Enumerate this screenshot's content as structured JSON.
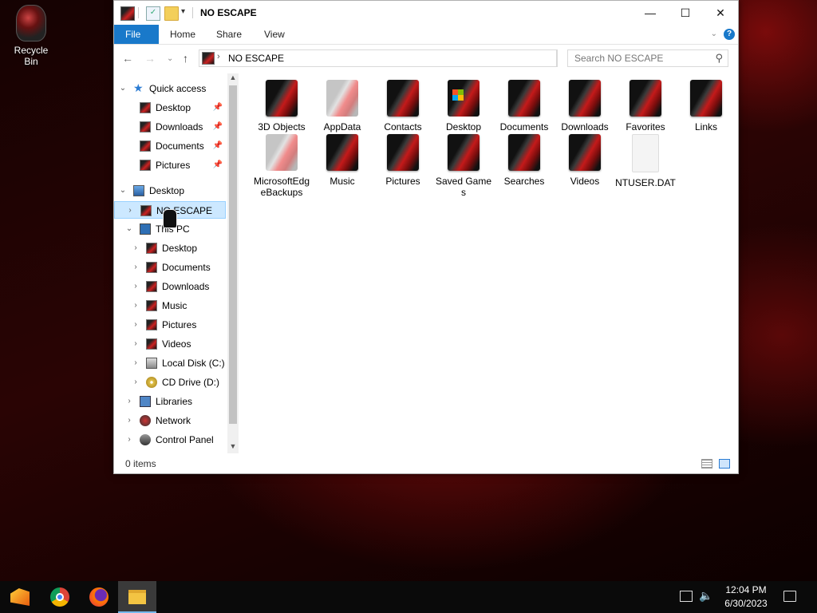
{
  "desktop": {
    "recycle_bin_label": "Recycle Bin"
  },
  "window": {
    "title": "NO ESCAPE",
    "ribbon_tabs": [
      "File",
      "Home",
      "Share",
      "View"
    ],
    "address_path": "NO ESCAPE",
    "search_placeholder": "Search NO ESCAPE",
    "status": "0 items"
  },
  "nav_tree": [
    {
      "label": "Quick access",
      "level": 0,
      "chevron": "down",
      "icon": "star-icon"
    },
    {
      "label": "Desktop",
      "level": 1,
      "pinned": true,
      "icon": "folder-icon"
    },
    {
      "label": "Downloads",
      "level": 1,
      "pinned": true,
      "icon": "downloads-icon"
    },
    {
      "label": "Documents",
      "level": 1,
      "pinned": true,
      "icon": "folder-icon"
    },
    {
      "label": "Pictures",
      "level": 1,
      "pinned": true,
      "icon": "pictures-icon"
    },
    {
      "label": "Desktop",
      "level": 0,
      "chevron": "down",
      "icon": "desktop-icon"
    },
    {
      "label": "NO ESCAPE",
      "level": 1,
      "chevron": "right",
      "icon": "user-folder-icon",
      "selected": true
    },
    {
      "label": "This PC",
      "level": 1,
      "chevron": "down",
      "icon": "computer-icon"
    },
    {
      "label": "Desktop",
      "level": 2,
      "chevron": "right",
      "icon": "folder-icon"
    },
    {
      "label": "Documents",
      "level": 2,
      "chevron": "right",
      "icon": "folder-icon"
    },
    {
      "label": "Downloads",
      "level": 2,
      "chevron": "right",
      "icon": "downloads-icon"
    },
    {
      "label": "Music",
      "level": 2,
      "chevron": "right",
      "icon": "music-icon"
    },
    {
      "label": "Pictures",
      "level": 2,
      "chevron": "right",
      "icon": "pictures-icon"
    },
    {
      "label": "Videos",
      "level": 2,
      "chevron": "right",
      "icon": "videos-icon"
    },
    {
      "label": "Local Disk (C:)",
      "level": 2,
      "chevron": "right",
      "icon": "disk-icon"
    },
    {
      "label": "CD Drive (D:)",
      "level": 2,
      "chevron": "right",
      "icon": "cd-icon"
    },
    {
      "label": "Libraries",
      "level": 1,
      "chevron": "right",
      "icon": "libraries-icon"
    },
    {
      "label": "Network",
      "level": 1,
      "chevron": "right",
      "icon": "network-icon"
    },
    {
      "label": "Control Panel",
      "level": 1,
      "chevron": "right",
      "icon": "control-panel-icon"
    }
  ],
  "files": [
    {
      "name": "3D Objects",
      "style": "dark"
    },
    {
      "name": "AppData",
      "style": "gray"
    },
    {
      "name": "Contacts",
      "style": "dark"
    },
    {
      "name": "Desktop",
      "style": "win"
    },
    {
      "name": "Documents",
      "style": "dark"
    },
    {
      "name": "Downloads",
      "style": "dark"
    },
    {
      "name": "Favorites",
      "style": "dark"
    },
    {
      "name": "Links",
      "style": "dark"
    },
    {
      "name": "MicrosoftEdgeBackups",
      "style": "gray"
    },
    {
      "name": "Music",
      "style": "dark"
    },
    {
      "name": "Pictures",
      "style": "dark"
    },
    {
      "name": "Saved Games",
      "style": "dark"
    },
    {
      "name": "Searches",
      "style": "dark"
    },
    {
      "name": "Videos",
      "style": "dark"
    },
    {
      "name": "NTUSER.DAT",
      "style": "file"
    }
  ],
  "taskbar": {
    "time": "12:04 PM",
    "date": "6/30/2023"
  }
}
